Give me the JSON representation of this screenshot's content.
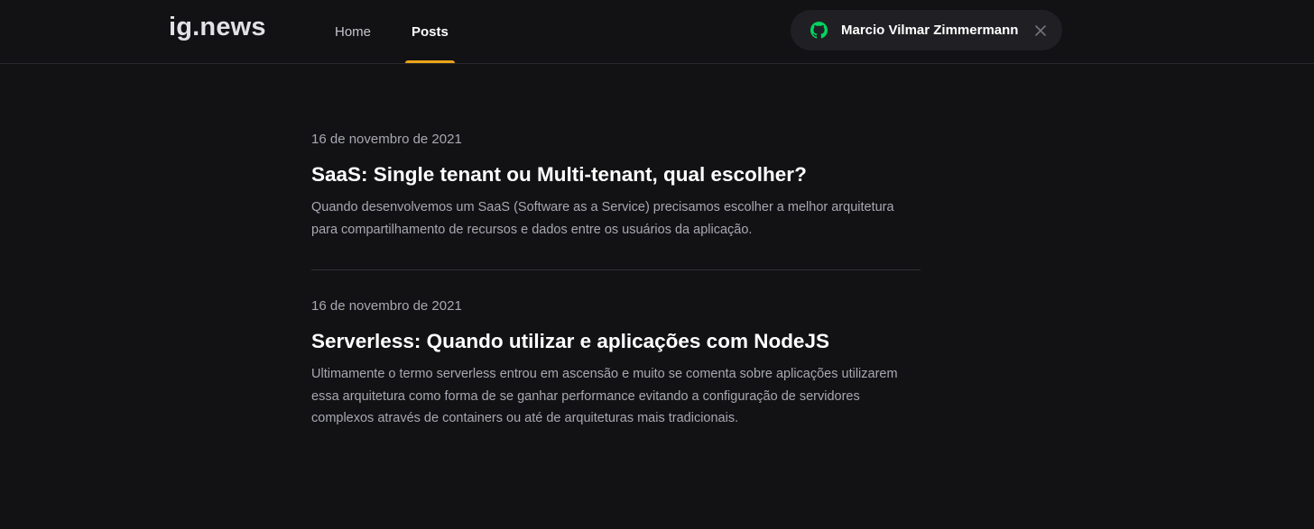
{
  "header": {
    "logo": "ig.news",
    "nav": [
      {
        "label": "Home",
        "active": false
      },
      {
        "label": "Posts",
        "active": true
      }
    ],
    "user": {
      "name": "Marcio Vilmar Zimmermann",
      "icon": "github-icon",
      "close_icon": "close-icon"
    }
  },
  "colors": {
    "background": "#121214",
    "accent": "#eba417",
    "github_icon": "#04d361"
  },
  "posts": [
    {
      "date": "16 de novembro de 2021",
      "title": "SaaS: Single tenant ou Multi-tenant, qual escolher?",
      "excerpt": "Quando desenvolvemos um SaaS (Software as a Service) precisamos escolher a melhor arquitetura para compartilhamento de recursos e dados entre os usuários da aplicação."
    },
    {
      "date": "16 de novembro de 2021",
      "title": "Serverless: Quando utilizar e aplicações com NodeJS",
      "excerpt": "Ultimamente o termo serverless entrou em ascensão e muito se comenta sobre aplicações utilizarem essa arquitetura como forma de se ganhar performance evitando a configuração de servidores complexos através de containers ou até de arquiteturas mais tradicionais."
    }
  ]
}
